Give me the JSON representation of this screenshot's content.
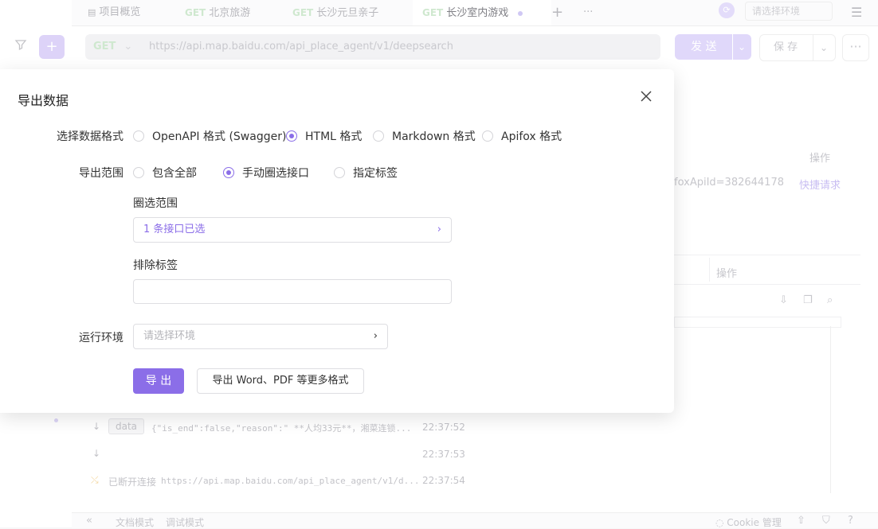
{
  "tabs": [
    {
      "method": "",
      "label": "项目概览"
    },
    {
      "method": "GET",
      "label": "北京旅游"
    },
    {
      "method": "GET",
      "label": "长沙元旦亲子"
    },
    {
      "method": "GET",
      "label": "长沙室内游戏"
    }
  ],
  "env_select_placeholder": "请选择环境",
  "request": {
    "method": "GET",
    "url": "https://api.map.baidu.com/api_place_agent/v1/deepsearch",
    "send_label": "发 送",
    "save_label": "保 存"
  },
  "background": {
    "ops_header_1": "操作",
    "api_id_text": "foxApiId=382644178",
    "quick_request": "快捷请求",
    "ops_header_2": "操作",
    "logs": [
      {
        "tag": "data",
        "text": "{\"is_end\":false,\"reason\":\" **人均33元**，湘菜连锁...",
        "time": "22:37:52"
      },
      {
        "tag": "",
        "text": "",
        "time": "22:37:53"
      },
      {
        "tag": "已断开连接",
        "text": "https://api.map.baidu.com/api_place_agent/v1/d...",
        "time": "22:37:54"
      }
    ],
    "bottom_tabs": [
      "文档模式",
      "调试模式"
    ],
    "cookie_label": "Cookie 管理"
  },
  "dialog": {
    "title": "导出数据",
    "format_label": "选择数据格式",
    "formats": [
      {
        "label": "OpenAPI 格式 (Swagger)",
        "selected": false
      },
      {
        "label": "HTML 格式",
        "selected": true
      },
      {
        "label": "Markdown 格式",
        "selected": false
      },
      {
        "label": "Apifox 格式",
        "selected": false
      }
    ],
    "scope_label": "导出范围",
    "scopes": [
      {
        "label": "包含全部",
        "selected": false
      },
      {
        "label": "手动圈选接口",
        "selected": true
      },
      {
        "label": "指定标签",
        "selected": false
      }
    ],
    "select_range_label": "圈选范围",
    "select_range_value": "1 条接口已选",
    "exclude_tags_label": "排除标签",
    "exclude_tags_value": "",
    "env_label": "运行环境",
    "env_placeholder": "请选择环境",
    "export_button": "导 出",
    "more_formats_button": "导出 Word、PDF 等更多格式"
  },
  "colors": {
    "accent": "#8b6ee8",
    "selected_text": "#8b6ee8"
  }
}
